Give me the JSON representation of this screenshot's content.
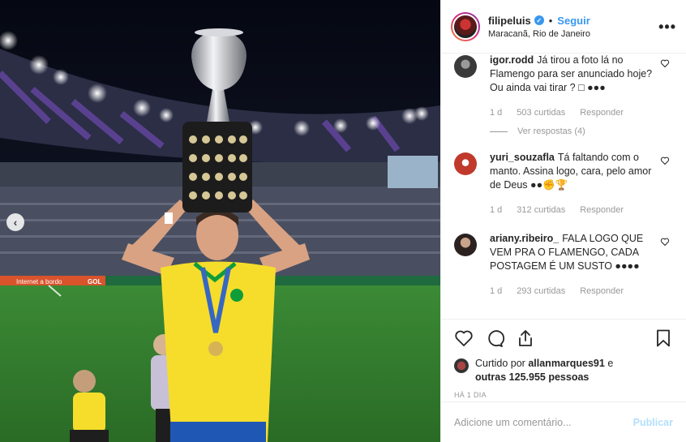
{
  "post": {
    "username": "filipeluis",
    "follow_label": "Seguir",
    "separator": "•",
    "location": "Maracanã, Rio de Janeiro",
    "more_label": "•••",
    "verified_glyph": "✓"
  },
  "photo": {
    "board_ad_1": "Internet a bordo",
    "board_ad_2": "GOL"
  },
  "comments": [
    {
      "user": "igor.rodd",
      "text": "Já tirou a foto lá no Flamengo para ser anunciado hoje? Ou ainda vai tirar ? □ ●●●",
      "time": "1 d",
      "likes": "503 curtidas",
      "reply": "Responder",
      "view_replies": "Ver respostas (4)",
      "avatar_color": "#3a3a3a"
    },
    {
      "user": "yuri_souzafla",
      "text": "Tá faltando com o manto. Assina logo, cara, pelo amor de Deus ●●✊🏆",
      "time": "1 d",
      "likes": "312 curtidas",
      "reply": "Responder",
      "avatar_color": "#c0392b"
    },
    {
      "user": "ariany.ribeiro_",
      "text": "FALA LOGO QUE VEM PRA O FLAMENGO, CADA POSTAGEM É UM SUSTO ●●●●",
      "time": "1 d",
      "likes": "293 curtidas",
      "reply": "Responder",
      "avatar_color": "#5b4a44"
    }
  ],
  "actions": {
    "liked_prefix": "Curtido por",
    "liked_user": "allanmarques91",
    "liked_middle": "e",
    "liked_others": "outras 125.955 pessoas",
    "date": "HÁ 1 DIA"
  },
  "add_comment": {
    "placeholder": "Adicione um comentário...",
    "publish_label": "Publicar"
  },
  "colors": {
    "accent": "#3897f0",
    "brazil_yellow": "#f6dd2c",
    "brazil_green": "#0f9d3a",
    "pitch": "#2f7a2b"
  }
}
